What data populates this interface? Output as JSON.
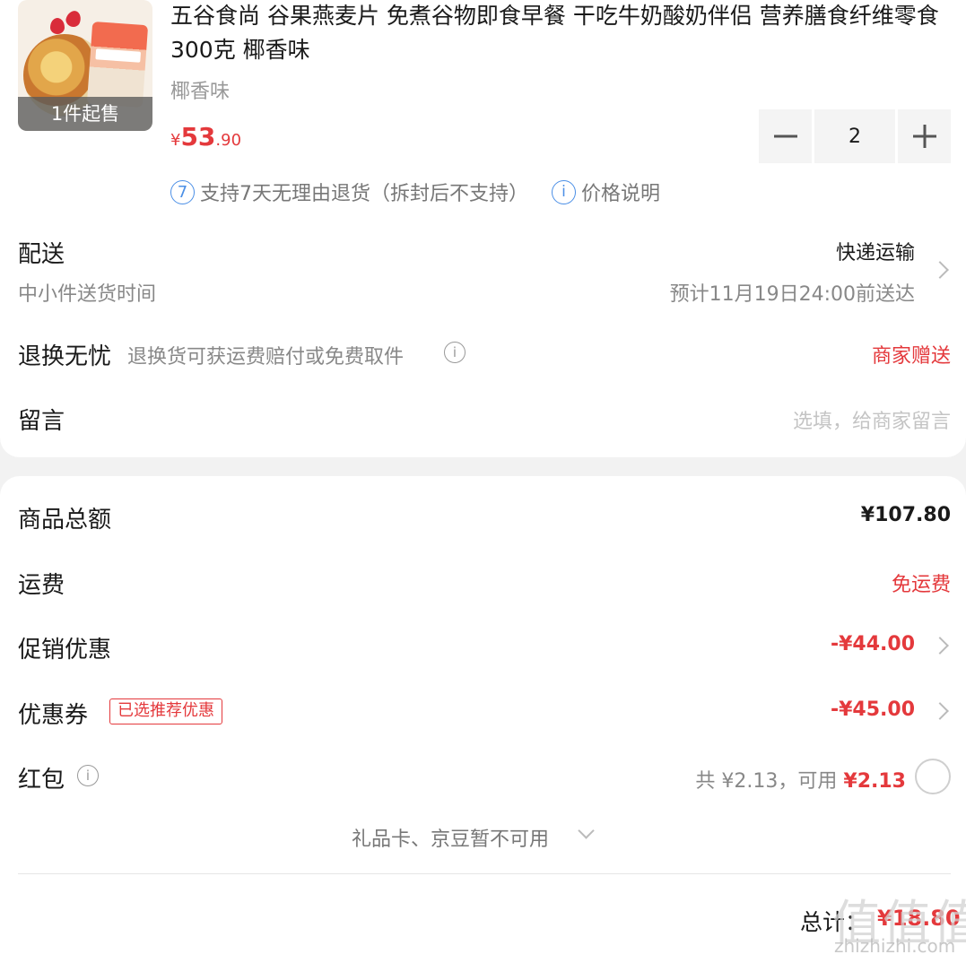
{
  "product": {
    "title": "五谷食尚 谷果燕麦片 免煮谷物即食早餐 干吃牛奶酸奶伴侣 营养膳食纤维零食 300克 椰香味",
    "variant": "椰香味",
    "min_order_badge": "1件起售",
    "price_currency": "¥",
    "price_int": "53",
    "price_dec": ".90",
    "quantity": "2",
    "return_policy_num": "7",
    "return_policy_text": "支持7天无理由退货（拆封后不支持）",
    "price_note": "价格说明"
  },
  "delivery": {
    "label": "配送",
    "sub": "中小件送货时间",
    "method": "快递运输",
    "eta": "预计11月19日24:00前送达"
  },
  "returns": {
    "label": "退换无忧",
    "desc": "退换货可获运费赔付或免费取件",
    "value": "商家赠送"
  },
  "message": {
    "label": "留言",
    "placeholder": "选填，给商家留言"
  },
  "summary": {
    "goods_total_label": "商品总额",
    "goods_total_value": "¥107.80",
    "shipping_label": "运费",
    "shipping_value": "免运费",
    "promo_label": "促销优惠",
    "promo_value": "-¥44.00",
    "coupon_label": "优惠券",
    "coupon_tag": "已选推荐优惠",
    "coupon_value": "-¥45.00",
    "redpacket_label": "红包",
    "redpacket_total": "共 ¥2.13，可用",
    "redpacket_avail": "¥2.13",
    "unavailable_note": "礼品卡、京豆暂不可用",
    "total_label": "总计：",
    "total_value": "¥18.80"
  },
  "watermark": {
    "main": "值值值",
    "sub": "zhizhizhi.com"
  },
  "colors": {
    "accent_red": "#e4393c",
    "info_blue": "#4b8fe6"
  }
}
